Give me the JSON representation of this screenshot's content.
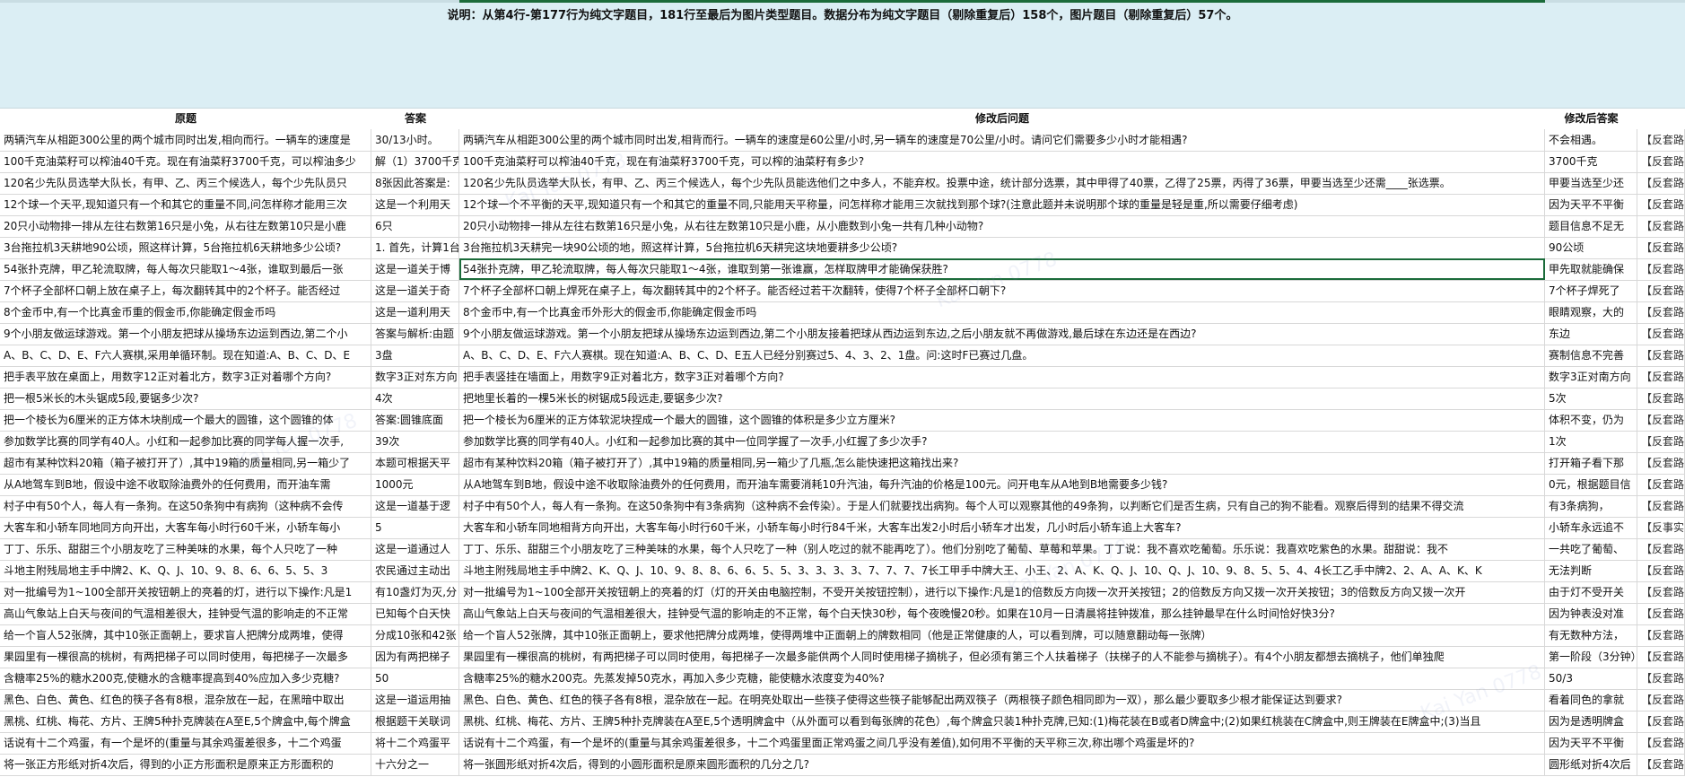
{
  "note": "说明：从第4行-第177行为纯文字题目，181行至最后为图片类型题目。数据分布为纯文字题目（剔除重复后）158个，图片题目（剔除重复后）57个。",
  "headers": [
    "原题",
    "答案",
    "修改后问题",
    "修改后答案",
    ""
  ],
  "watermark": "Kai Yan 0778",
  "rows": [
    [
      "两辆汽车从相距300公里的两个城市同时出发,相向而行。一辆车的速度是",
      "30/13小时。",
      "两辆汽车从相距300公里的两个城市同时出发,相背而行。一辆车的速度是60公里/小时,另一辆车的速度是70公里/小时。请问它们需要多少小时才能相遇?",
      "不会相遇。",
      "【反套路】"
    ],
    [
      "100千克油菜籽可以榨油40千克。现在有油菜籽3700千克，可以榨油多少",
      "解（1）3700千克",
      "100千克油菜籽可以榨油40千克，现在有油菜籽3700千克，可以榨的油菜籽有多少?",
      "3700千克",
      "【反套路】"
    ],
    [
      "120名少先队员选举大队长，有甲、乙、丙三个候选人，每个少先队员只",
      "8张因此答案是:",
      "120名少先队员选举大队长，有甲、乙、丙三个候选人，每个少先队员能选他们之中多人，不能弃权。投票中途，统计部分选票，其中甲得了40票，乙得了25票，丙得了36票，甲要当选至少还需____张选票。",
      "甲要当选至少还",
      "【反套路】"
    ],
    [
      "12个球一个天平,现知道只有一个和其它的重量不同,问怎样称才能用三次",
      "这是一个利用天",
      "12个球一个不平衡的天平,现知道只有一个和其它的重量不同,只能用天平称量，问怎样称才能用三次就找到那个球?(注意此题并未说明那个球的重量是轻是重,所以需要仔细考虑)",
      "因为天平不平衡",
      "【反套路】"
    ],
    [
      "20只小动物排一排从左往右数第16只是小兔，从右往左数第10只是小鹿",
      "6只",
      "20只小动物排一排从左往右数第16只是小兔，从右往左数第10只是小鹿，从小鹿数到小兔一共有几种小动物?",
      "题目信息不足无",
      "【反套路】"
    ],
    [
      "3台拖拉机3天耕地90公顷，照这样计算，5台拖拉机6天耕地多少公顷?",
      "1. 首先，计算1台",
      "3台拖拉机3天耕完一块90公顷的地，照这样计算，5台拖拉机6天耕完这块地要耕多少公顷?",
      "90公顷",
      "【反套路】"
    ],
    [
      "54张扑克牌，甲乙轮流取牌，每人每次只能取1～4张，谁取到最后一张",
      "这是一道关于博",
      "54张扑克牌，甲乙轮流取牌，每人每次只能取1～4张，谁取到第一张谁赢，怎样取牌甲才能确保获胜?",
      "甲先取就能确保",
      "【反套路】"
    ],
    [
      "7个杯子全部杯口朝上放在桌子上，每次翻转其中的2个杯子。能否经过",
      "这是一道关于奇",
      "7个杯子全部杯口朝上焊死在桌子上，每次翻转其中的2个杯子。能否经过若干次翻转，使得7个杯子全部杯口朝下?",
      "7个杯子焊死了",
      "【反套路】"
    ],
    [
      "8个金币中,有一个比真金币重的假金币,你能确定假金币吗",
      "这是一道利用天",
      "8个金币中,有一个比真金币外形大的假金币,你能确定假金币吗",
      "眼睛观察，大的",
      "【反套路】"
    ],
    [
      "9个小朋友做运球游戏。第一个小朋友把球从操场东边运到西边,第二个小",
      "答案与解析:由题",
      "9个小朋友做运球游戏。第一个小朋友把球从操场东边运到西边,第二个小朋友接着把球从西边运到东边,之后小朋友就不再做游戏,最后球在东边还是在西边?",
      "东边",
      "【反套路】"
    ],
    [
      "A、B、C、D、E、F六人赛棋,采用单循环制。现在知道:A、B、C、D、E",
      "3盘",
      "A、B、C、D、E、F六人赛棋。现在知道:A、B、C、D、E五人已经分别赛过5、4、3、2、1盘。问:这时F已赛过几盘。",
      "赛制信息不完善",
      "【反套路】"
    ],
    [
      "把手表平放在桌面上，用数字12正对着北方，数字3正对着哪个方向?",
      "数字3正对东方向",
      "把手表竖挂在墙面上，用数字9正对着北方，数字3正对着哪个方向?",
      "数字3正对南方向",
      "【反套路】"
    ],
    [
      "把一根5米长的木头锯成5段,要锯多少次?",
      "4次",
      "把地里长着的一棵5米长的树锯成5段远走,要锯多少次?",
      "5次",
      "【反套路】"
    ],
    [
      "把一个棱长为6厘米的正方体木块削成一个最大的圆锥，这个圆锥的体",
      "答案:圆锥底面",
      "把一个棱长为6厘米的正方体软泥块捏成一个最大的圆锥，这个圆锥的体积是多少立方厘米?",
      "体积不变，仍为",
      "【反套路】"
    ],
    [
      "参加数学比赛的同学有40人。小红和一起参加比赛的同学每人握一次手,",
      "39次",
      "参加数学比赛的同学有40人。小红和一起参加比赛的其中一位同学握了一次手,小红握了多少次手?",
      "1次",
      "【反套路】"
    ],
    [
      "超市有某种饮料20箱（箱子被打开了）,其中19箱的质量相同,另一箱少了",
      "本题可根据天平",
      "超市有某种饮料20箱（箱子被打开了）,其中19箱的质量相同,另一箱少了几瓶,怎么能快速把这箱找出来?",
      "打开箱子看下那",
      "【反套路】"
    ],
    [
      "从A地驾车到B地，假设中途不收取除油费外的任何费用，而开油车需",
      "1000元",
      "从A地驾车到B地，假设中途不收取除油费外的任何费用，而开油车需要消耗10升汽油，每升汽油的价格是100元。问开电车从A地到B地需要多少钱?",
      "0元，根据题目信",
      "【反套路】"
    ],
    [
      "村子中有50个人，每人有一条狗。在这50条狗中有病狗（这种病不会传",
      "这是一道基于逻",
      "村子中有50个人，每人有一条狗。在这50条狗中有3条病狗（这种病不会传染）。于是人们就要找出病狗。每个人可以观察其他的49条狗，以判断它们是否生病，只有自己的狗不能看。观察后得到的结果不得交流",
      "有3条病狗，",
      "【反套路】"
    ],
    [
      "大客车和小轿车同地同方向开出，大客车每小时行60千米，小轿车每小",
      "5",
      "大客车和小轿车同地相背方向开出，大客车每小时行60千米，小轿车每小时行84千米，大客车出发2小时后小轿车才出发，几小时后小轿车追上大客车?",
      "小轿车永远追不",
      "【反事实】"
    ],
    [
      "丁丁、乐乐、甜甜三个小朋友吃了三种美味的水果，每个人只吃了一种",
      "这是一道通过人",
      "丁丁、乐乐、甜甜三个小朋友吃了三种美味的水果，每个人只吃了一种（别人吃过的就不能再吃了）。他们分别吃了葡萄、草莓和苹果。丁丁说：我不喜欢吃葡萄。乐乐说：我喜欢吃紫色的水果。甜甜说：我不",
      "一共吃了葡萄、",
      "【反套路】"
    ],
    [
      "斗地主附残局地主手中牌2、K、Q、J、10、9、8、6、6、5、5、3",
      "农民通过主动出",
      "斗地主附残局地主手中牌2、K、Q、J、10、9、8、8、6、6、5、5、3、3、3、3、7、7、7、7长工甲手中牌大王、小王、2、A、K、Q、J、10、Q、J、10、9、8、5、5、4、4长工乙手中牌2、2、A、A、K、K",
      "无法判断",
      "【反套路】"
    ],
    [
      "对一批编号为1~100全部开关按钮朝上的亮着的灯，进行以下操作:凡是1",
      "有10盏灯为灭,分",
      "对一批编号为1~100全部开关按钮朝上的亮着的灯（灯的开关由电脑控制，不受开关按钮控制），进行以下操作:凡是1的倍数反方向拨一次开关按钮；2的倍数反方向又拨一次开关按钮；3的倍数反方向又拨一次开",
      "由于灯不受开关",
      "【反套路】"
    ],
    [
      "高山气象站上白天与夜间的气温相差很大，挂钟受气温的影响走的不正常",
      "已知每个白天快",
      "高山气象站上白天与夜间的气温相差很大，挂钟受气温的影响走的不正常，每个白天快30秒，每个夜晚慢20秒。如果在10月一日清晨将挂钟拨准，那么挂钟最早在什么时间恰好快3分?",
      "因为钟表没对准",
      "【反套路】"
    ],
    [
      "给一个盲人52张牌，其中10张正面朝上，要求盲人把牌分成两堆，使得",
      "分成10张和42张",
      "给一个盲人52张牌，其中10张正面朝上，要求他把牌分成两堆，使得两堆中正面朝上的牌数相同（他是正常健康的人，可以看到牌，可以随意翻动每一张牌）",
      "有无数种方法，",
      "【反套路】"
    ],
    [
      "果园里有一棵很高的桃树，有两把梯子可以同时使用，每把梯子一次最多",
      "因为有两把梯子",
      "果园里有一棵很高的桃树，有两把梯子可以同时使用，每把梯子一次最多能供两个人同时使用梯子摘桃子，但必须有第三个人扶着梯子（扶梯子的人不能参与摘桃子）。有4个小朋友都想去摘桃子，他们单独爬",
      "第一阶段（3分钟）",
      "【反套路】"
    ],
    [
      "含糖率25%的糖水200克,使糖水的含糖率提高到40%应加入多少克糖?",
      "50",
      "含糖率25%的糖水200克。先蒸发掉50克水，再加入多少克糖，能使糖水浓度变为40%?",
      "50/3",
      "【反套路】"
    ],
    [
      "黑色、白色、黄色、红色的筷子各有8根，混杂放在一起，在黑暗中取出",
      "这是一道运用抽",
      "黑色、白色、黄色、红色的筷子各有8根，混杂放在一起。在明亮处取出一些筷子使得这些筷子能够配出两双筷子（两根筷子颜色相同即为一双），那么最少要取多少根才能保证达到要求?",
      "看着同色的拿就",
      "【反套路】"
    ],
    [
      "黑桃、红桃、梅花、方片、王牌5种扑克牌装在A至E,5个牌盒中,每个牌盒",
      "根据题干关联词",
      "黑桃、红桃、梅花、方片、王牌5种扑克牌装在A至E,5个透明牌盒中（从外面可以看到每张牌的花色）,每个牌盒只装1种扑克牌,已知:(1)梅花装在B或者D牌盒中;(2)如果红桃装在C牌盒中,则王牌装在E牌盒中;(3)当且",
      "因为是透明牌盒",
      "【反套路】"
    ],
    [
      "话说有十二个鸡蛋，有一个是坏的(重量与其余鸡蛋差很多，十二个鸡蛋",
      "将十二个鸡蛋平",
      "话说有十二个鸡蛋，有一个是坏的(重量与其余鸡蛋差很多，十二个鸡蛋里面正常鸡蛋之间几乎没有差值),如何用不平衡的天平称三次,称出哪个鸡蛋是坏的?",
      "因为天平不平衡",
      "【反套路】"
    ],
    [
      "将一张正方形纸对折4次后，得到的小正方形面积是原来正方形面积的",
      "十六分之一",
      "将一张圆形纸对折4次后，得到的小圆形面积是原来圆形面积的几分之几?",
      "圆形纸对折4次后",
      "【反套路】"
    ]
  ]
}
